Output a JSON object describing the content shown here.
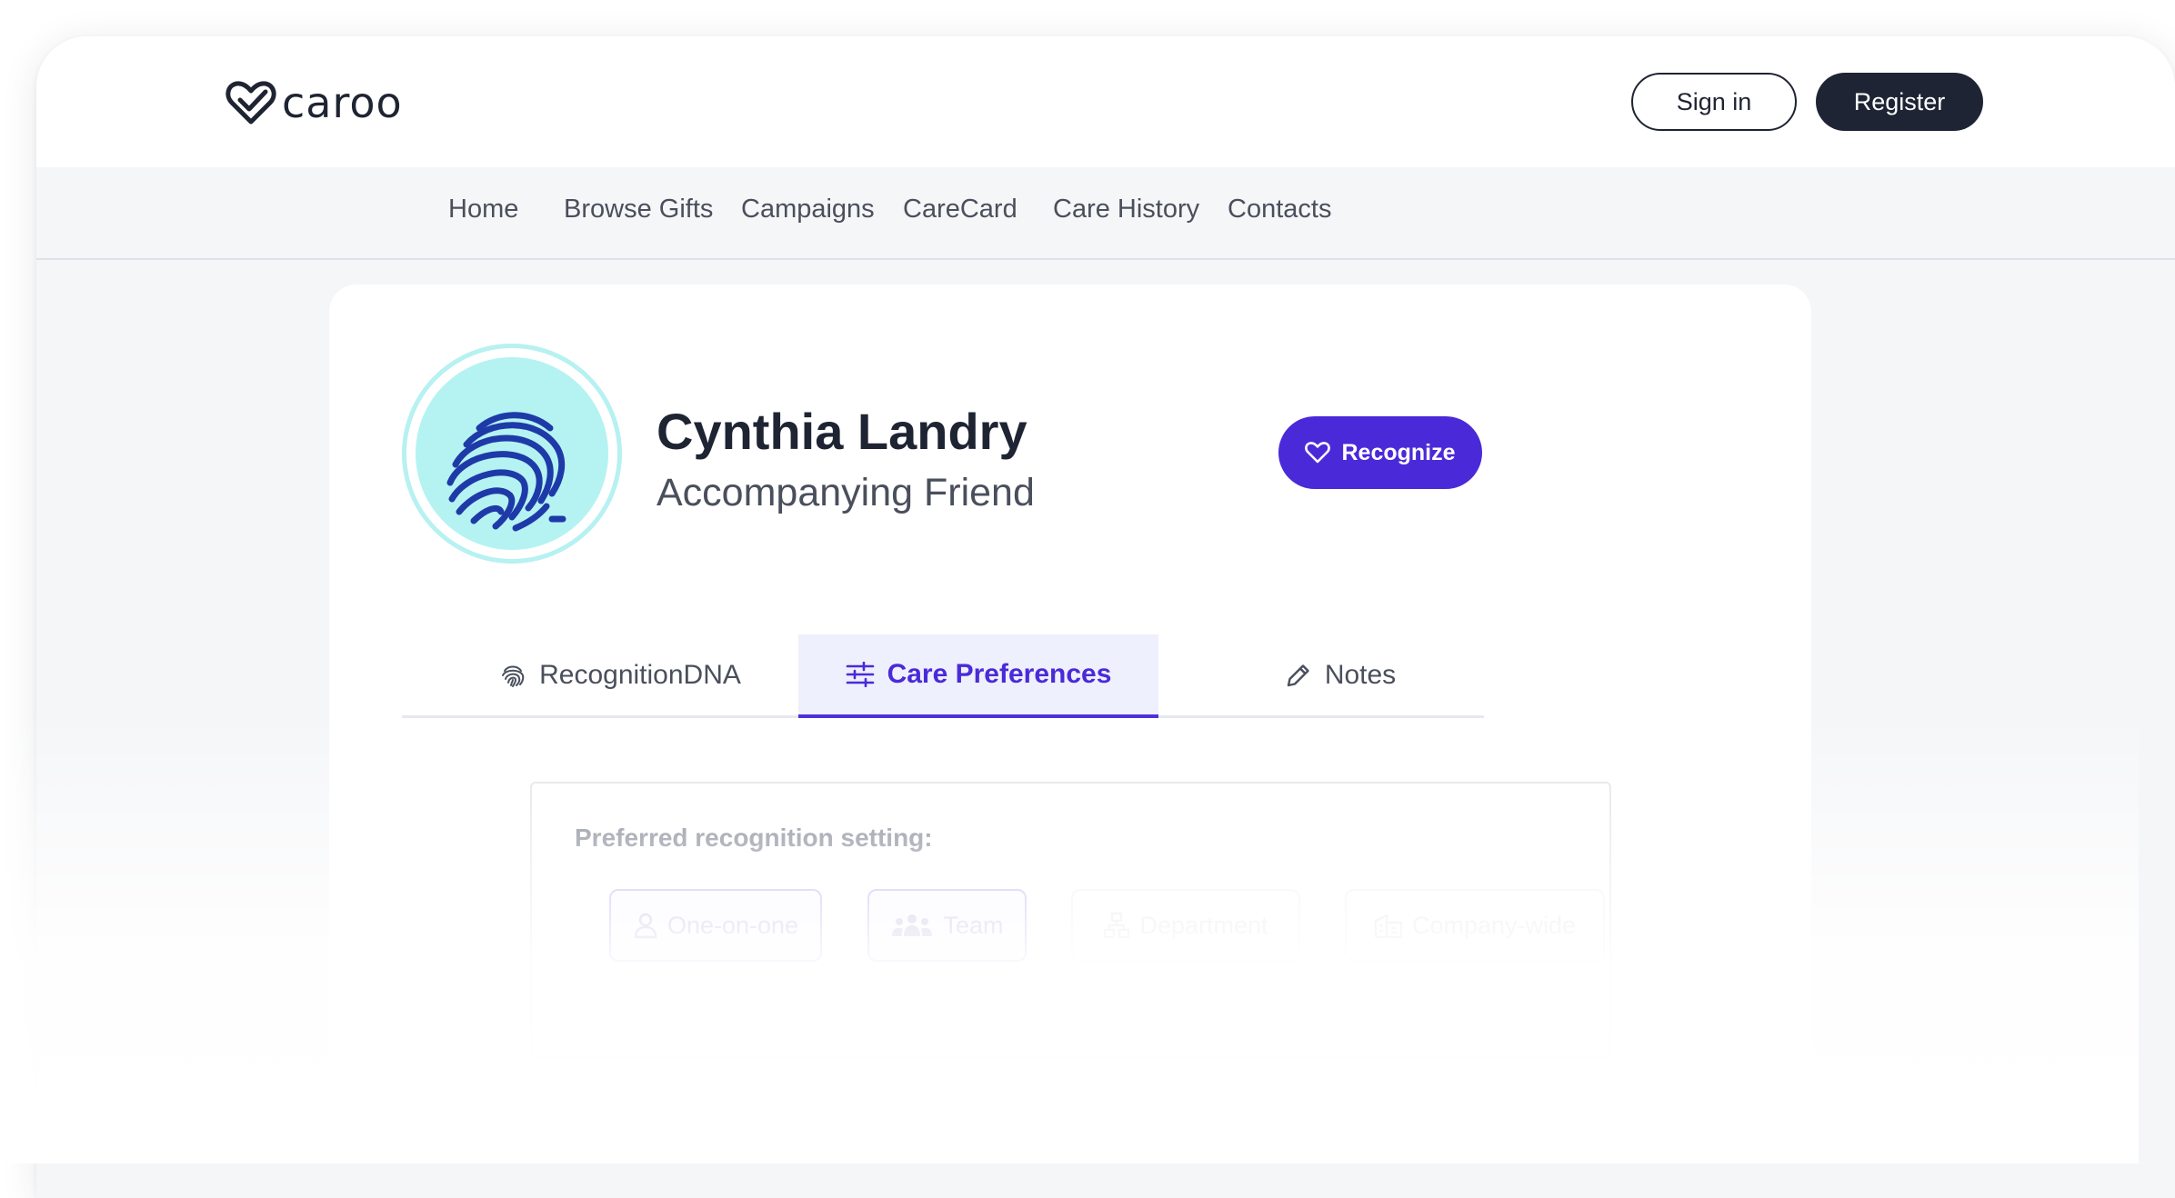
{
  "brand": {
    "name": "caroo",
    "logo_icon": "heart-check-icon"
  },
  "header": {
    "signin_label": "Sign in",
    "register_label": "Register"
  },
  "nav": {
    "items": [
      "Home",
      "Browse Gifts",
      "Campaigns",
      "CareCard",
      "Care History",
      "Contacts"
    ]
  },
  "profile": {
    "name": "Cynthia Landry",
    "role": "Accompanying Friend",
    "avatar_icon": "fingerprint-icon",
    "recognize_label": "Recognize"
  },
  "tabs": [
    {
      "label": "RecognitionDNA",
      "icon": "fingerprint-icon",
      "active": false
    },
    {
      "label": "Care Preferences",
      "icon": "sliders-icon",
      "active": true
    },
    {
      "label": "Notes",
      "icon": "pencil-icon",
      "active": false
    }
  ],
  "preferences": {
    "title": "Preferred recognition setting:",
    "options": [
      {
        "label": "One-on-one",
        "icon": "person-icon",
        "selected": true
      },
      {
        "label": "Team",
        "icon": "team-icon",
        "selected": true
      },
      {
        "label": "Department",
        "icon": "org-chart-icon",
        "selected": false
      },
      {
        "label": "Company-wide",
        "icon": "building-icon",
        "selected": false
      }
    ]
  },
  "colors": {
    "accent": "#4a2ad8",
    "dark": "#1e2433",
    "avatar_bg": "#b4f3f1",
    "fingerprint": "#1e3aa8"
  }
}
